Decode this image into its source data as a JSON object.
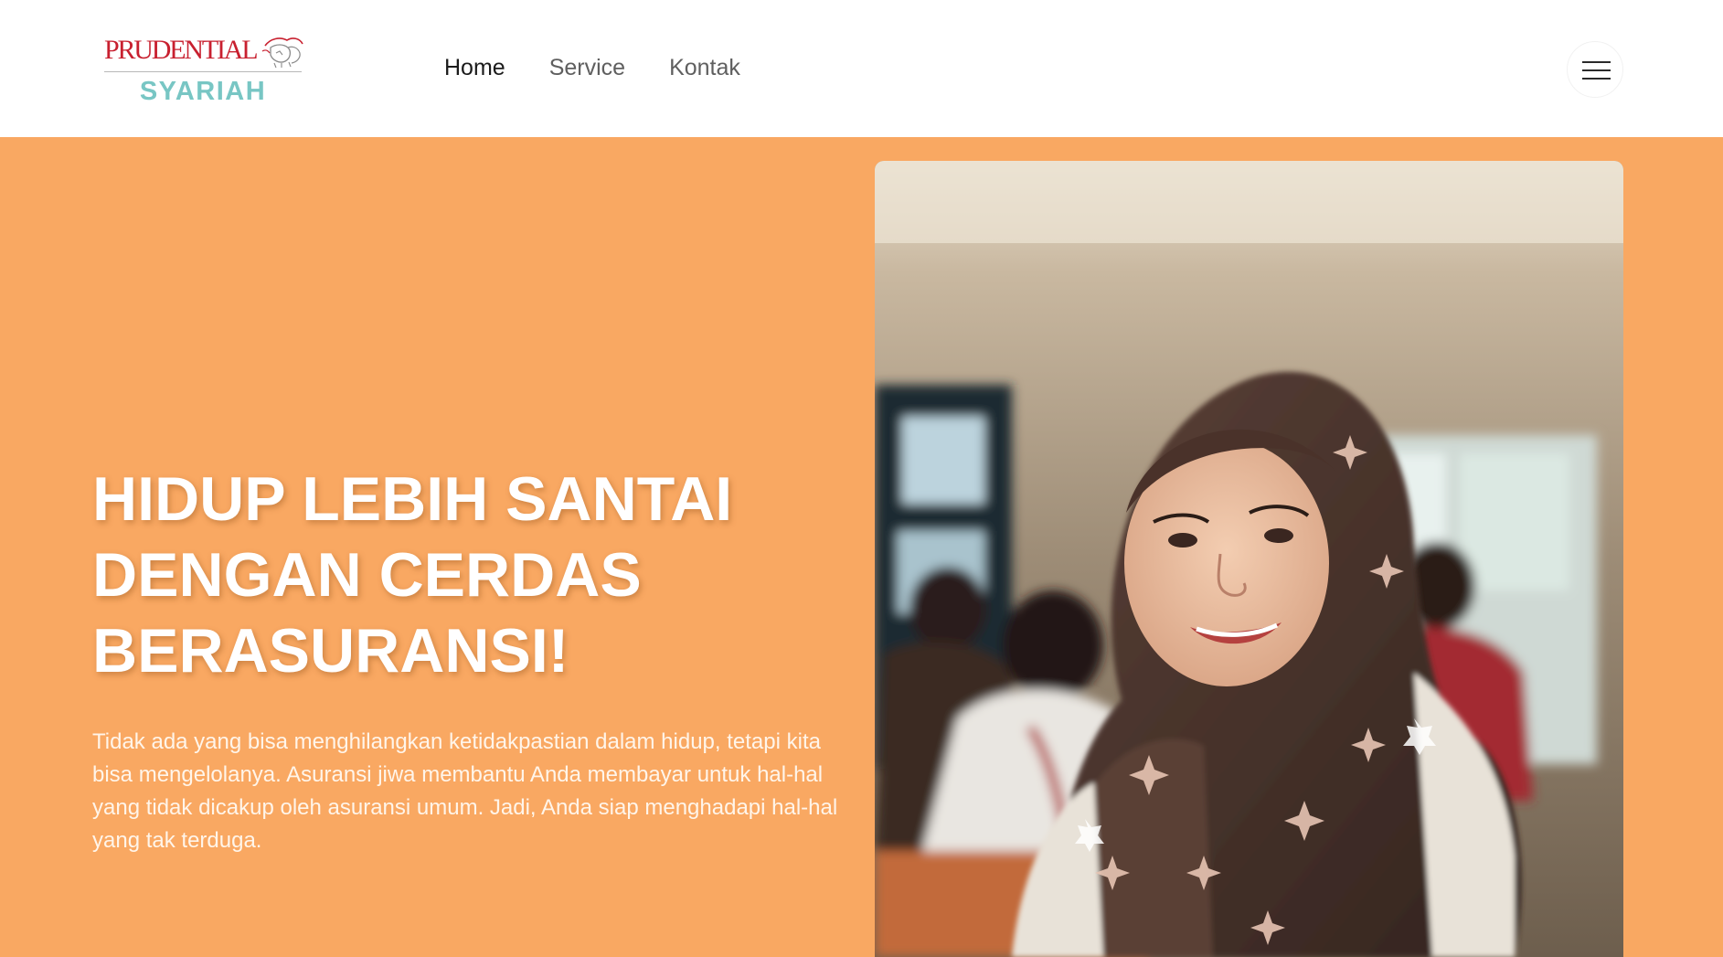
{
  "brand": {
    "name": "PRUDENTIAL",
    "sub": "SYARIAH",
    "colors": {
      "red": "#c8202f",
      "teal": "#78c6c4"
    }
  },
  "nav": {
    "items": [
      {
        "label": "Home",
        "active": true
      },
      {
        "label": "Service",
        "active": false
      },
      {
        "label": "Kontak",
        "active": false
      }
    ],
    "menu_icon": "hamburger-icon"
  },
  "hero": {
    "background": "#f9a862",
    "headline_lines": [
      "HIDUP LEBIH SANTAI",
      "DENGAN CERDAS",
      "BERASURANSI!"
    ],
    "description": "Tidak ada yang bisa menghilangkan ketidakpastian dalam hidup, tetapi kita bisa mengelolanya. Asuransi jiwa membantu Anda membayar untuk hal-hal yang tidak dicakup oleh asuransi umum. Jadi, Anda siap menghadapi hal-hal yang tak terduga."
  }
}
